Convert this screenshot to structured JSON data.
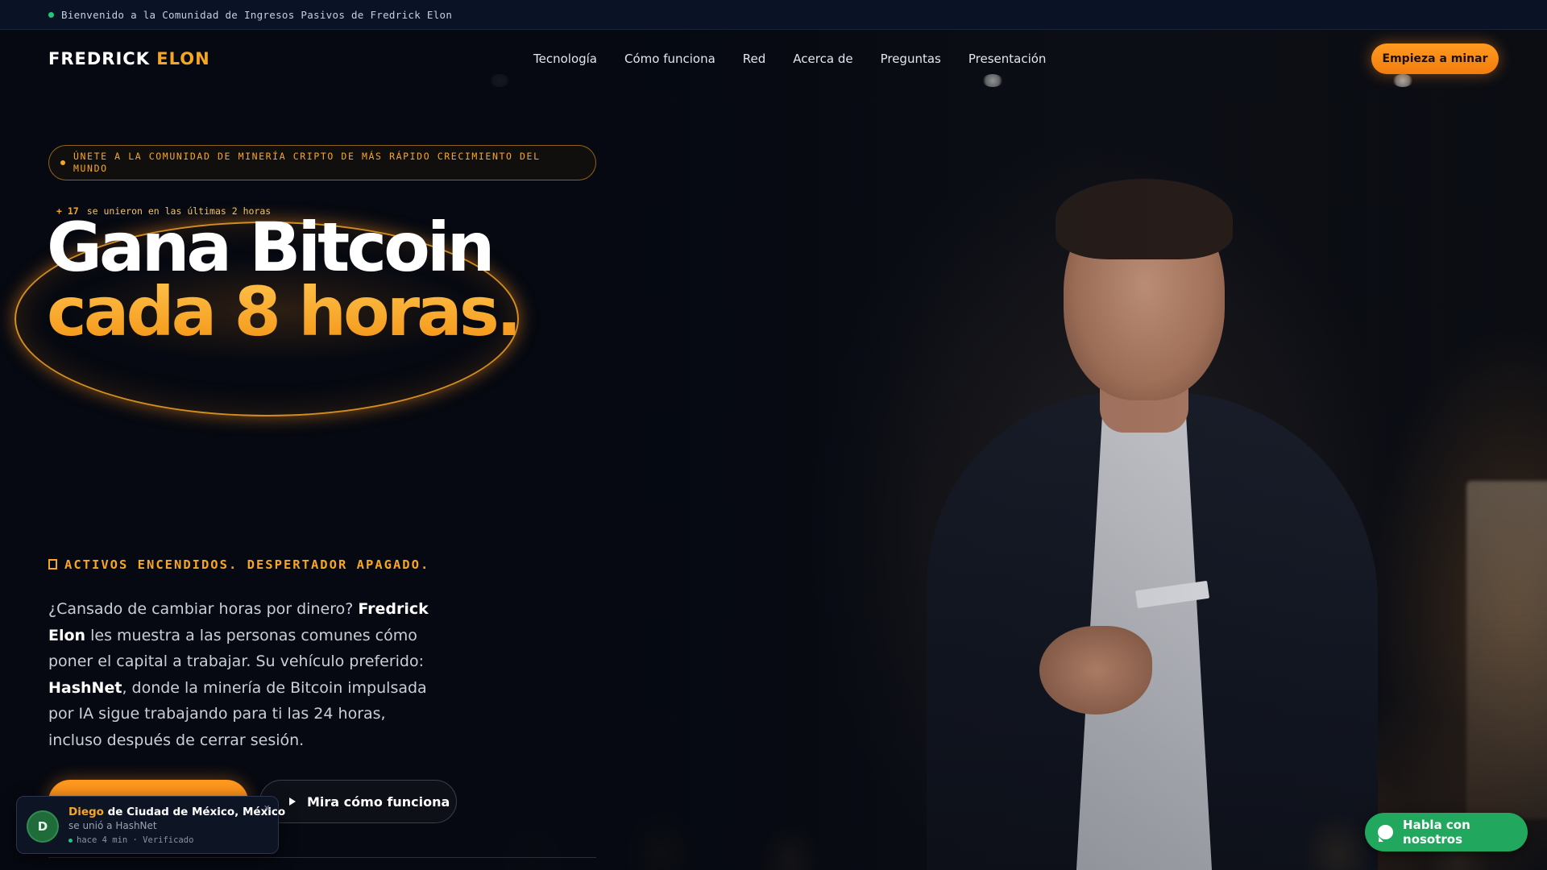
{
  "announcement": {
    "text": "Bienvenido a la Comunidad de Ingresos Pasivos de Fredrick Elon"
  },
  "brand": {
    "first": "FREDRICK",
    "second": "ELON",
    "accent_color": "#f7a623"
  },
  "nav": {
    "links": [
      "Tecnología",
      "Cómo funciona",
      "Red",
      "Acerca de",
      "Preguntas",
      "Presentación"
    ],
    "cta": "Empieza a minar"
  },
  "hero": {
    "pill": "ÚNETE A LA COMUNIDAD DE MINERÍA CRIPTO DE MÁS RÁPIDO CRECIMIENTO DEL MUNDO",
    "joined_count": "+ 17",
    "joined_text": "se unieron en las últimas 2 horas",
    "headline_line1": "Gana Bitcoin",
    "headline_line2": "cada 8 horas.",
    "kicker": "ACTIVOS ENCENDIDOS. DESPERTADOR APAGADO.",
    "desc": {
      "p1": "¿Cansado de cambiar horas por dinero? ",
      "b1": "Fredrick Elon",
      "p2": " les muestra a las personas comunes cómo poner el capital a trabajar. Su vehículo preferido: ",
      "b2": "HashNet",
      "p3": ", donde la minería de Bitcoin impulsada por IA sigue trabajando para ti las 24 horas, incluso después de cerrar sesión."
    },
    "watch_button": "Mira cómo funciona"
  },
  "toast": {
    "avatar_initial": "D",
    "name": "Diego",
    "location": " de Ciudad de México, México",
    "subtitle": "se unió a HashNet",
    "meta": "hace 4 min · Verificado",
    "close": "×"
  },
  "chat": {
    "label": "Habla con nosotros",
    "color": "#22a85e"
  }
}
